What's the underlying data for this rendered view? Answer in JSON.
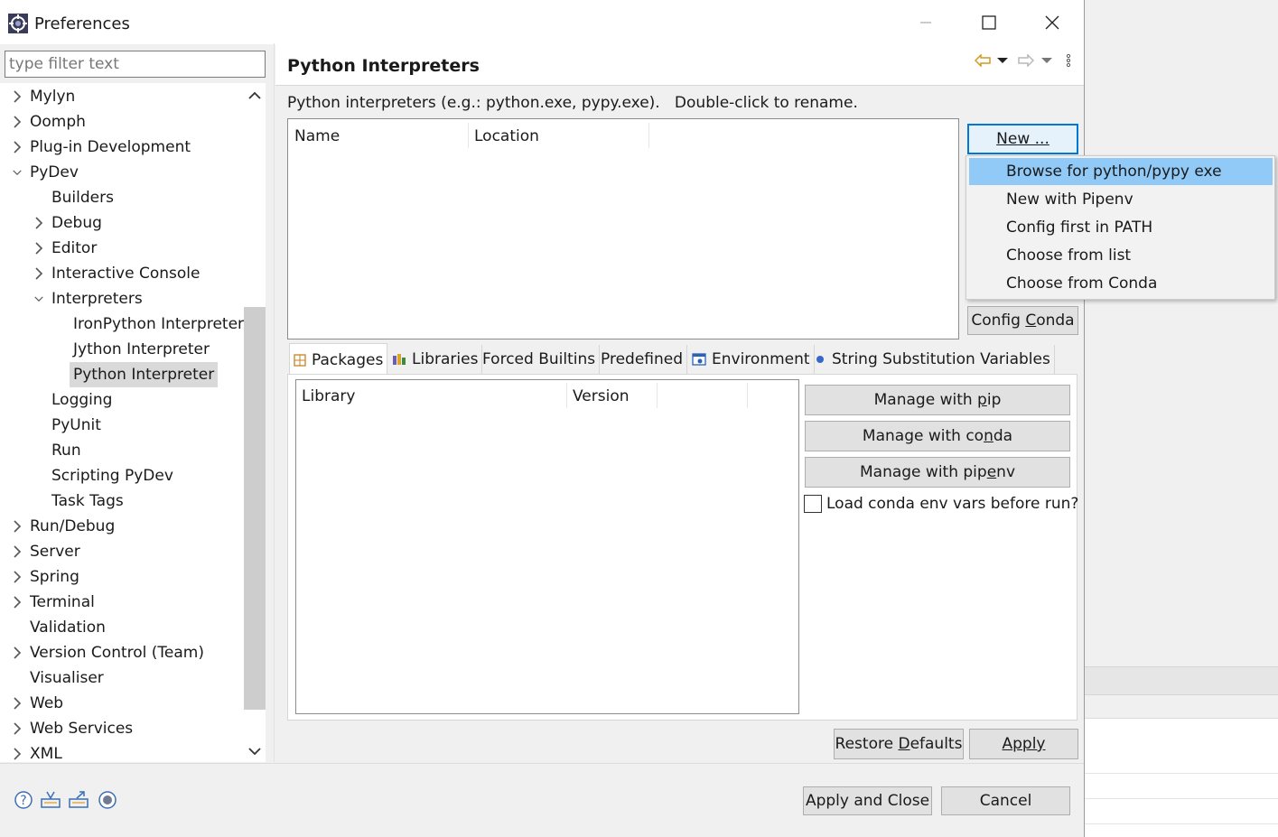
{
  "window": {
    "title": "Preferences"
  },
  "filter": {
    "placeholder": "type filter text"
  },
  "tree": {
    "items": [
      {
        "label": "Mylyn",
        "level": 0,
        "arrow": "right"
      },
      {
        "label": "Oomph",
        "level": 0,
        "arrow": "right"
      },
      {
        "label": "Plug-in Development",
        "level": 0,
        "arrow": "right"
      },
      {
        "label": "PyDev",
        "level": 0,
        "arrow": "down"
      },
      {
        "label": "Builders",
        "level": 1,
        "arrow": "none"
      },
      {
        "label": "Debug",
        "level": 1,
        "arrow": "right"
      },
      {
        "label": "Editor",
        "level": 1,
        "arrow": "right"
      },
      {
        "label": "Interactive Console",
        "level": 1,
        "arrow": "right"
      },
      {
        "label": "Interpreters",
        "level": 1,
        "arrow": "down"
      },
      {
        "label": "IronPython Interpreter",
        "level": 2,
        "arrow": "none"
      },
      {
        "label": "Jython Interpreter",
        "level": 2,
        "arrow": "none"
      },
      {
        "label": "Python Interpreter",
        "level": 2,
        "arrow": "none",
        "selected": true
      },
      {
        "label": "Logging",
        "level": 1,
        "arrow": "none"
      },
      {
        "label": "PyUnit",
        "level": 1,
        "arrow": "none"
      },
      {
        "label": "Run",
        "level": 1,
        "arrow": "none"
      },
      {
        "label": "Scripting PyDev",
        "level": 1,
        "arrow": "none"
      },
      {
        "label": "Task Tags",
        "level": 1,
        "arrow": "none"
      },
      {
        "label": "Run/Debug",
        "level": 0,
        "arrow": "right"
      },
      {
        "label": "Server",
        "level": 0,
        "arrow": "right"
      },
      {
        "label": "Spring",
        "level": 0,
        "arrow": "right"
      },
      {
        "label": "Terminal",
        "level": 0,
        "arrow": "right"
      },
      {
        "label": "Validation",
        "level": 0,
        "arrow": "none"
      },
      {
        "label": "Version Control (Team)",
        "level": 0,
        "arrow": "right"
      },
      {
        "label": "Visualiser",
        "level": 0,
        "arrow": "none"
      },
      {
        "label": "Web",
        "level": 0,
        "arrow": "right"
      },
      {
        "label": "Web Services",
        "level": 0,
        "arrow": "right"
      },
      {
        "label": "XML",
        "level": 0,
        "arrow": "right"
      }
    ]
  },
  "page": {
    "title": "Python Interpreters",
    "description": "Python interpreters (e.g.: python.exe, pypy.exe).   Double-click to rename."
  },
  "interp_table": {
    "columns": [
      "Name",
      "Location"
    ]
  },
  "buttons": {
    "new_pre": "N",
    "new_ul": "e",
    "new_post": "w ...",
    "config_conda_pre": "Config ",
    "config_conda_ul": "C",
    "config_conda_post": "onda",
    "manage_pip_pre": "Manage with ",
    "manage_pip_ul": "p",
    "manage_pip_post": "ip",
    "manage_conda_pre": "Manage with co",
    "manage_conda_ul": "n",
    "manage_conda_post": "da",
    "manage_pipenv_pre": "Manage with pip",
    "manage_pipenv_ul": "e",
    "manage_pipenv_post": "nv",
    "restore_pre": "Restore ",
    "restore_ul": "D",
    "restore_post": "efaults",
    "apply_ul": "A",
    "apply_post": "pply",
    "apply_close": "Apply and Close",
    "cancel": "Cancel"
  },
  "new_menu": {
    "items": [
      {
        "label": "Browse for python/pypy exe",
        "highlighted": true
      },
      {
        "label": "New with Pipenv"
      },
      {
        "label": "Config first in PATH"
      },
      {
        "label": "Choose from list"
      },
      {
        "label": "Choose from Conda"
      }
    ]
  },
  "tabs": [
    {
      "label": "Packages",
      "icon": "packages-icon",
      "active": true
    },
    {
      "label": "Libraries",
      "icon": "libraries-icon"
    },
    {
      "label": "Forced Builtins",
      "icon": ""
    },
    {
      "label": "Predefined",
      "icon": ""
    },
    {
      "label": "Environment",
      "icon": "environment-icon"
    },
    {
      "label": "String Substitution Variables",
      "icon": "variable-icon"
    }
  ],
  "lib_table": {
    "columns": [
      "Library",
      "Version"
    ]
  },
  "checkbox": {
    "label": "Load conda env vars before run?",
    "checked": false
  },
  "colors": {
    "selection": "#91c9f7",
    "focus_border": "#0078d7",
    "tree_selected": "#d9d9d9"
  }
}
